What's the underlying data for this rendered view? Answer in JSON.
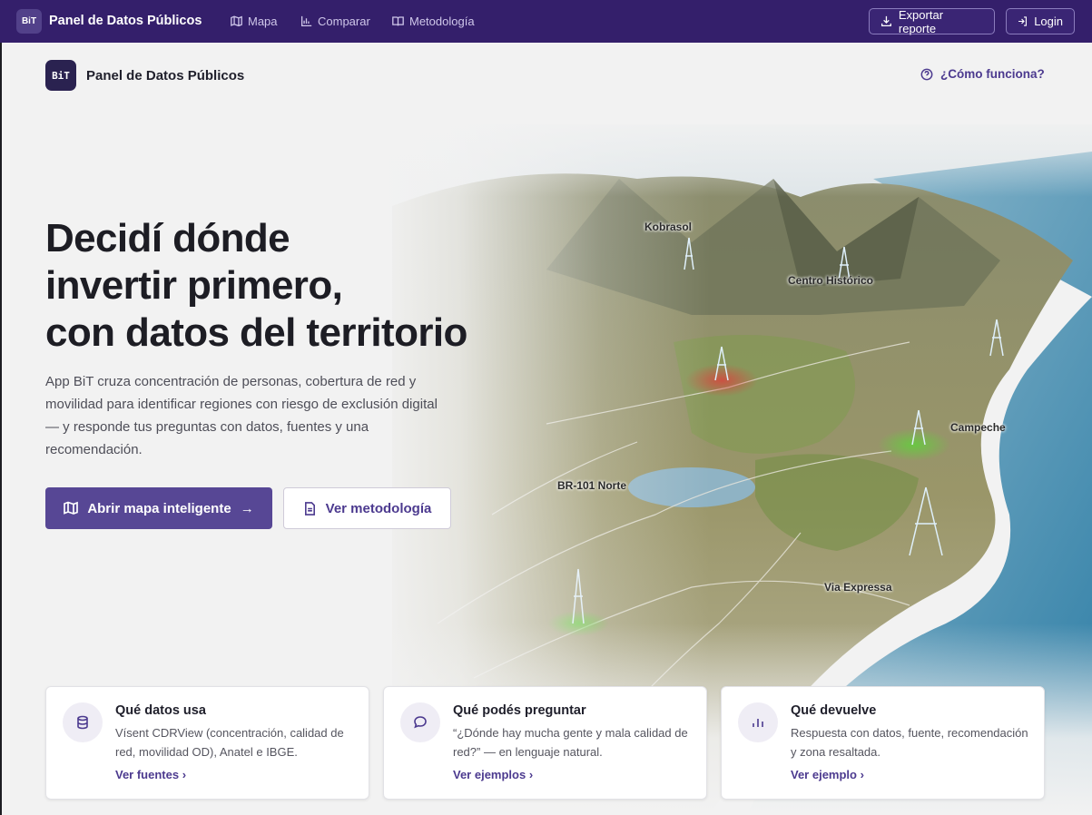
{
  "topbar": {
    "logo": "BiT",
    "title": "Panel de Datos Públicos",
    "nav": [
      {
        "label": "Mapa",
        "icon": "map-icon"
      },
      {
        "label": "Comparar",
        "icon": "bar-chart-icon"
      },
      {
        "label": "Metodología",
        "icon": "book-icon"
      }
    ],
    "export_label": "Exportar reporte",
    "login_label": "Login"
  },
  "header": {
    "logo": "BiT",
    "title": "Panel de Datos Públicos",
    "help_label": "¿Cómo funciona?"
  },
  "hero": {
    "headline_lines": [
      "Decidí dónde",
      "invertir primero,",
      "con datos del territorio"
    ],
    "lead": "App BiT cruza concentración de personas, cobertura de red y movilidad para identificar regiones con riesgo de exclusión digital — y responde tus preguntas con datos, fuentes y una recomendación.",
    "primary_button": "Abrir mapa inteligente",
    "primary_arrow": "→",
    "secondary_button": "Ver metodología"
  },
  "map_labels": {
    "kobrasol": "Kobrasol",
    "centro": "Centro Histórico",
    "campeche": "Campeche",
    "br101": "BR-101 Norte",
    "via": "Via Expressa"
  },
  "cards": [
    {
      "icon": "database-icon",
      "title": "Qué datos usa",
      "text": "Vísent CDRView (concentración, calidad de red, movilidad OD), Anatel e IBGE.",
      "link": "Ver fuentes ›"
    },
    {
      "icon": "chat-bubble-icon",
      "title": "Qué podés preguntar",
      "text": "“¿Dónde hay mucha gente y mala calidad de red?” — en lenguaje natural.",
      "link": "Ver ejemplos ›"
    },
    {
      "icon": "bar-chart-icon",
      "title": "Qué devuelve",
      "text": "Respuesta con datos, fuente, recomendación y zona resaltada.",
      "link": "Ver ejemplo ›"
    }
  ],
  "colors": {
    "topbar": "#341f6b",
    "accent": "#574795",
    "link": "#4c3a8f",
    "page_bg": "#f2f2f2"
  }
}
